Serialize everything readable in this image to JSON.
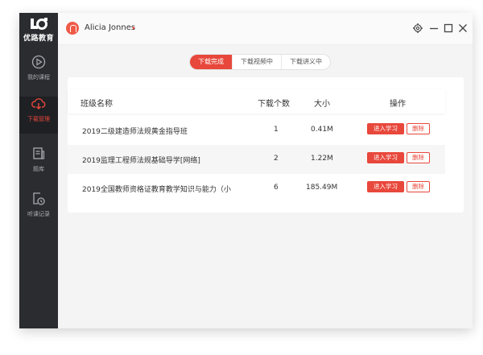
{
  "brand": {
    "name": "优路教育"
  },
  "sidebar": {
    "items": [
      {
        "label": "我的课程",
        "icon": "play-circle-icon"
      },
      {
        "label": "下载管理",
        "icon": "cloud-download-icon",
        "active": true
      },
      {
        "label": "题库",
        "icon": "question-bank-icon"
      },
      {
        "label": "听课记录",
        "icon": "history-icon"
      }
    ]
  },
  "header": {
    "username": "Alicia Jonnes",
    "caret": "▾",
    "controls": [
      "settings-icon",
      "minimize-icon",
      "maximize-icon",
      "close-icon"
    ]
  },
  "tabs": [
    {
      "label": "下载完成",
      "active": true
    },
    {
      "label": "下载视频中"
    },
    {
      "label": "下载讲义中"
    }
  ],
  "table": {
    "headers": {
      "name": "班级名称",
      "count": "下载个数",
      "size": "大小",
      "action": "操作"
    },
    "rows": [
      {
        "name": "2019二级建造师法规黄金指导班",
        "count": "1",
        "size": "0.41M"
      },
      {
        "name": "2019监理工程师法规基础导学[网络]",
        "count": "2",
        "size": "1.22M"
      },
      {
        "name": "2019全国教师资格证教育教学知识与能力（小",
        "count": "6",
        "size": "185.49M"
      }
    ],
    "study_label": "进入学习",
    "delete_label": "删除"
  },
  "colors": {
    "accent": "#e8473b",
    "sidebar": "#2a2c30"
  }
}
